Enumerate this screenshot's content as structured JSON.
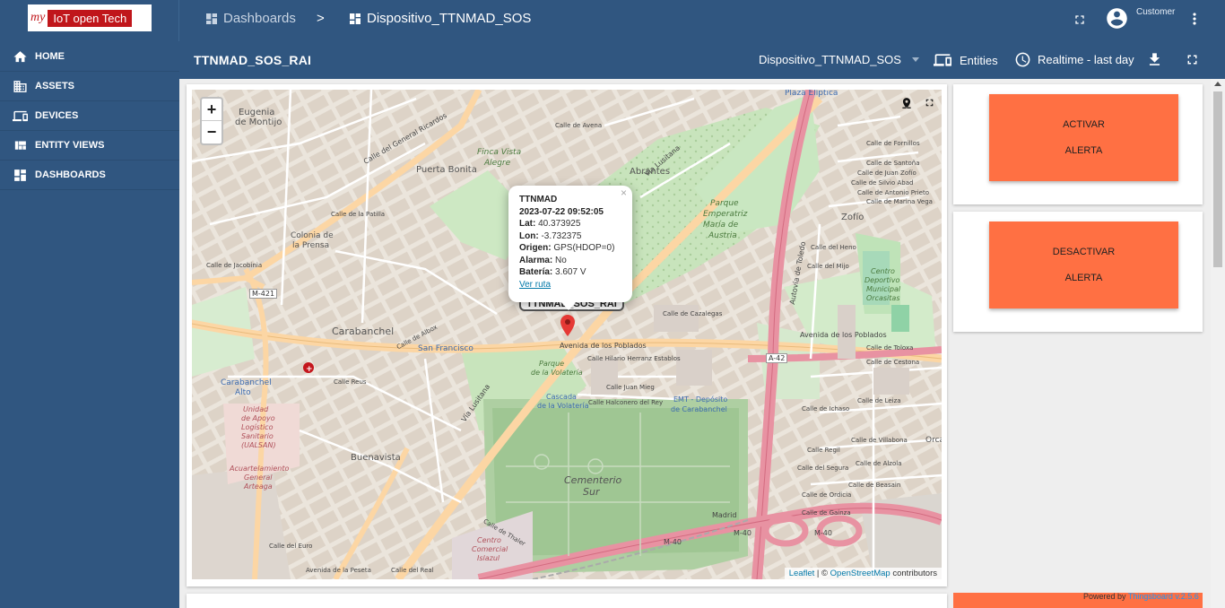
{
  "logo": {
    "prefix": "my",
    "tag": "IoT open Tech"
  },
  "sidebar": {
    "items": [
      {
        "label": "HOME",
        "icon": "home-icon"
      },
      {
        "label": "ASSETS",
        "icon": "business-icon"
      },
      {
        "label": "DEVICES",
        "icon": "devices-icon"
      },
      {
        "label": "ENTITY VIEWS",
        "icon": "view-quilt-icon"
      },
      {
        "label": "DASHBOARDS",
        "icon": "dashboard-icon"
      }
    ]
  },
  "header": {
    "breadcrumb": [
      "Dashboards",
      "Dispositivo_TTNMAD_SOS"
    ],
    "separator": ">",
    "user_role": "Customer"
  },
  "dashboard": {
    "title": "TTNMAD_SOS_RAI",
    "entity_alias": "Dispositivo_TTNMAD_SOS",
    "entities_label": "Entities",
    "timewindow": "Realtime - last day"
  },
  "map": {
    "popup": {
      "name": "TTNMAD",
      "timestamp": "2023-07-22 09:52:05",
      "lat_label": "Lat:",
      "lat": "40.373925",
      "lon_label": "Lon:",
      "lon": "-3.732375",
      "origin_label": "Origen:",
      "origin": "GPS(HDOP=0)",
      "alarm_label": "Alarma:",
      "alarm": "No",
      "battery_label": "Batería:",
      "battery": "3.607 V",
      "link": "Ver ruta",
      "close": "×"
    },
    "marker_label": "TTNMAD_SOS_RAI",
    "zoom_in": "+",
    "zoom_out": "−",
    "attribution": {
      "leaflet": "Leaflet",
      "sep": " | © ",
      "osm": "OpenStreetMap",
      "suffix": " contributors"
    },
    "labels": {
      "plaza_eliptica": "Plaza Elíptica",
      "eugenia": "Eugenia",
      "de_montijo": "de Montijo",
      "puerta_bonita": "Puerta Bonita",
      "finca": "Finca Vista",
      "alegre": "Alegre",
      "abrantes": "Abrantes",
      "parque_emp": "Parque",
      "parque_emp2": "Emperatriz",
      "parque_emp3": "María de",
      "parque_emp4": "Austria",
      "zofio": "Zofío",
      "colonia": "Colonia de",
      "colonia2": "la Prensa",
      "carabanchel": "Carabanchel",
      "san_francisco": "San Francisco",
      "carabanchel_alto": "Carabanchel",
      "carabanchel_alto2": "Alto",
      "buenavista": "Buenavista",
      "parque_volateria": "Parque",
      "parque_volateria2": "de la Volatería",
      "cascada": "Cascada",
      "cascada2": "de la Volatería",
      "emt": "EMT - Depósito",
      "emt2": "de Carabanchel",
      "cementerio": "Cementerio",
      "cementerio2": "Sur",
      "centro_deportivo": "Centro",
      "centro_deportivo2": "Deportivo",
      "centro_deportivo3": "Municipal",
      "centro_deportivo4": "Orcasitas",
      "avenida_poblados": "Avenida de los Poblados",
      "avenida_poblados2": "Avenida de los Poblados",
      "autovia_toledo": "Autovía de Toledo",
      "via_lusitana": "Vía Lusitana",
      "via_lusitana2": "Vía Lusitana",
      "calle_general_ricardos": "Calle del General Ricardos",
      "m421": "M-421",
      "a42": "A-42",
      "m40": "M-40",
      "m40b": "M-40",
      "m40c": "M-40",
      "unidad": "Unidad",
      "unidad2": "de Apoyo",
      "unidad3": "Logístico",
      "unidad4": "Sanitario",
      "unidad5": "(UALSAN)",
      "acuartelamiento": "Acuartelamiento",
      "acuartelamiento2": "General",
      "acuartelamiento3": "Arteaga",
      "centro_comercial": "Centro",
      "centro_comercial2": "Comercial",
      "centro_comercial3": "Islazul",
      "calle_jacobinia": "Calle de Jacobinia",
      "calle_patilla": "Calle de la Patilla",
      "calle_albox": "Calle de Albox",
      "calle_reus": "Calle Reus",
      "calle_hilario": "Calle Hilario Herranz Establos",
      "calle_juan_mieg": "Calle Juan Mieg",
      "calle_halconero": "Calle Halconero del Rey",
      "calle_cazalegas": "Calle de Cazalegas",
      "calle_toloxa": "Calle de Toloxa",
      "calle_cestona": "Calle de Cestona",
      "calle_ichaso": "Calle de Ichaso",
      "calle_leiza": "Calle de Leiza",
      "calle_villabona": "Calle de Villabona",
      "calle_regil": "Calle Regil",
      "calle_segura": "Calle del Segura",
      "calle_ordicia": "Calle de Ordicia",
      "calle_gainza": "Calle de Gainza",
      "calle_beasain": "Calle de Beasain",
      "calle_alzola": "Calle de Alzola",
      "calle_fornillos": "Calle de Fornillos",
      "calle_santoña": "Calle de Santoña",
      "calle_juan_zofio": "Calle de Juan Zofío",
      "calle_silvio": "Calle de Silvio Abad",
      "calle_antonio": "Calle de Antonio Prieto",
      "calle_marina": "Calle de Marina Vega",
      "calle_heno": "Calle del Heno",
      "calle_mijo": "Calle del Mijo",
      "calle_thaler": "Calle de Thaler",
      "calle_euro": "Calle del Euro",
      "avenida_peseta": "Avenida de la Peseta",
      "calle_real": "Calle del Real",
      "calle_avena": "Calle de Avena",
      "madrid": "Madrid",
      "orca": "Orca"
    }
  },
  "buttons": {
    "activar": {
      "line1": "ACTIVAR",
      "line2": "ALERTA"
    },
    "desactivar": {
      "line1": "DESACTIVAR",
      "line2": "ALERTA"
    }
  },
  "footer": {
    "powered": "Powered by ",
    "brand": "Thingsboard v.2.5.6"
  },
  "colors": {
    "header": "#305680",
    "alert_button": "#ff7043",
    "accent_link": "#0078a8"
  }
}
